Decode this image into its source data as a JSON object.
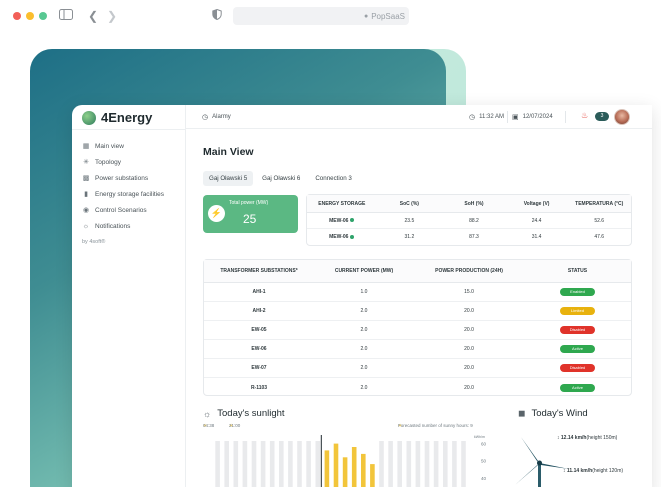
{
  "browser": {
    "url": "PopSaaS"
  },
  "app": {
    "brand": "4Energy",
    "nav": [
      {
        "label": "Main view",
        "icon": "grid-icon"
      },
      {
        "label": "Topology",
        "icon": "topology-icon"
      },
      {
        "label": "Power substations",
        "icon": "substation-icon"
      },
      {
        "label": "Energy storage facilities",
        "icon": "battery-icon"
      },
      {
        "label": "Control Scenarios",
        "icon": "control-icon"
      },
      {
        "label": "Notifications",
        "icon": "bell-icon"
      }
    ],
    "footer": "by 4soft®"
  },
  "topbar": {
    "alarm": "Alarmy",
    "time": "11:32 AM",
    "date": "12/07/2024",
    "notification_count": "3"
  },
  "main": {
    "title": "Main View",
    "tabs": [
      "Gaj Oławski 5",
      "Gaj Oławski 6",
      "Connection 3"
    ],
    "total_power": {
      "label": "Total power (MW)",
      "value": "25"
    },
    "storage": {
      "headers": [
        "ENERGY STORAGE",
        "SoC (%)",
        "SoH (%)",
        "Voltage (V)",
        "TEMPERATURA (°C)"
      ],
      "rows": [
        [
          "MEW-06",
          "23.5",
          "88.2",
          "24.4",
          "52.6"
        ],
        [
          "MEW-06",
          "31.2",
          "87.3",
          "31.4",
          "47.6"
        ]
      ]
    },
    "substations": {
      "headers": [
        "TRANSFORMER SUBSTATIONS*",
        "CURRENT POWER (MW)",
        "POWER PRODUCTION (24H)",
        "STATUS"
      ],
      "rows": [
        {
          "name": "AHI-1",
          "power": "1.0",
          "production": "15.0",
          "status": "Enabled",
          "status_color": "#2fa84f"
        },
        {
          "name": "AHI-2",
          "power": "2.0",
          "production": "20.0",
          "status": "Limited",
          "status_color": "#e8b20e"
        },
        {
          "name": "EW-05",
          "power": "2.0",
          "production": "20.0",
          "status": "Disabled",
          "status_color": "#e0332a"
        },
        {
          "name": "EW-06",
          "power": "2.0",
          "production": "20.0",
          "status": "Active",
          "status_color": "#2fa84f"
        },
        {
          "name": "EW-07",
          "power": "2.0",
          "production": "20.0",
          "status": "Disabled",
          "status_color": "#e0332a"
        },
        {
          "name": "R-1103",
          "power": "2.0",
          "production": "20.0",
          "status": "Active",
          "status_color": "#2fa84f"
        }
      ]
    },
    "sunlight": {
      "title": "Today's sunlight",
      "sunrise": "04:38",
      "sunset": "21:00",
      "forecast_label": "Forecasted number of sunny hours: 9"
    },
    "wind": {
      "title": "Today's Wind",
      "stat1_value": "12.14 km/h",
      "stat1_label": "(height 150m)",
      "stat2_value": "11.14 km/h",
      "stat2_label": "(height 120m)"
    }
  },
  "chart_data": {
    "type": "bar",
    "title": "Today's sunlight",
    "ylabel": "kWh/m",
    "yticks": [
      "60",
      "50",
      "40"
    ],
    "ylim": [
      30,
      65
    ],
    "bars": 28,
    "highlight_bars": [
      12,
      13,
      14,
      15,
      16,
      17
    ],
    "values": [
      36,
      36,
      36,
      36,
      36,
      36,
      36,
      36,
      36,
      36,
      36,
      36,
      56,
      60,
      52,
      58,
      54,
      48,
      36,
      36,
      36,
      36,
      36,
      36,
      36,
      36,
      36,
      36
    ]
  },
  "colors": {
    "accent_green": "#5bb883",
    "chart_highlight": "#f2c53b",
    "chart_muted": "#e9eaec"
  }
}
